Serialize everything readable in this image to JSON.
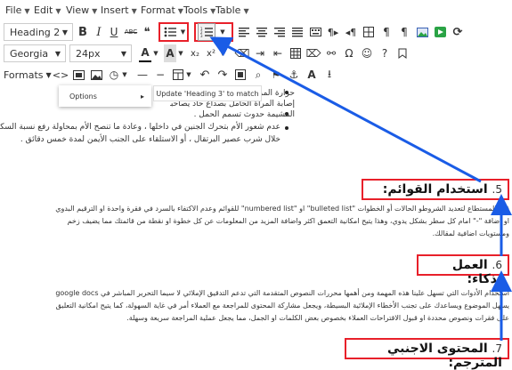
{
  "menubar": {
    "file": "File",
    "edit": "Edit",
    "view": "View",
    "insert": "Insert",
    "format": "Format",
    "tools": "Tools",
    "table": "Table"
  },
  "toolbar1": {
    "heading_select": "Heading 2",
    "bold": "B",
    "italic": "I",
    "underline": "U",
    "strike": "ABC",
    "quote": "❝"
  },
  "toolbar2": {
    "font_select": "Georgia",
    "size_select": "24px",
    "text_color_letter": "A",
    "bg_color_letter": "A"
  },
  "toolbar3": {
    "formats": "Formats"
  },
  "popup": {
    "options": "Options",
    "arrow": "▸"
  },
  "tooltip": {
    "text": "Update 'Heading 3' to match"
  },
  "content": {
    "bullet_line1": "حرارة المرأة بمعدل طبيعي من الطبيعي دون",
    "bullet_line2": "إصابة المرأة الحامل بصداع حاد يصاحبه",
    "bullet_line3": "المشيمة حدوث تسمم الحمل .",
    "bullet_line4": "عدم شعور الأم بتحرك الجنين في داخلها ، وعادة ما تنصح الأم بمحاولة رفع نسبة السكر من",
    "bullet_line5": "خلال شرب عصير البرتقال ، أو الاستلقاء على الجنب الأيمن لمدة خمس دقائق .",
    "heading5_num": "5.",
    "heading5": "استخدام القوائم:",
    "para5_line1": "قدر المستطاع لتعديد الشروطو الحالات أو الخطوات \"bulleted list\" او \"numbered list\" للقوائم وعدم الاكتفاء بالسرد في فقرة واحدة او الترقيم البدوي",
    "para5_line2": "او اضافة \"-\" امام كل سطر بشكل يدوي، وهذا يتيح امكانية التعمق اكثر واضافة المزيد من المعلومات عن كل خطوة او نقطة من قائمتك مما يضيف زخم",
    "para5_line3": "ومستويات اضافية لمقالك.",
    "heading6_num": "6.",
    "heading6": "العمل بذكاء:",
    "para6_line1": "استخدام الأدوات التي تسهل علينا هذه المهمة ومن أهمها محررات النصوص المتقدمة التي تدعم التدقيق الإملائي لا سيما التحرير المباشر في google docs",
    "para6_line2": "يسهل الموضوع ويساعدك على تجنب الأخطاء الإملائية البسيطة، ويجعل مشاركة المحتوى للمراجعة مع العملاء أمر في غاية السهولة، كما يتيح امكانية التعليق",
    "para6_line3": "على فقرات ونصوص محددة او قبول الاقتراحات العملاء بخصوص بعض الكلمات او الجمل، مما يجعل عملية المراجعة سريعة وسهلة.",
    "heading7_num": "7.",
    "heading7": "المحتوى الاجنبي المترجم:"
  },
  "colors": {
    "highlight_red": "#e8202a",
    "arrow_blue": "#1a5ce6",
    "green_icon": "#2aa345"
  }
}
